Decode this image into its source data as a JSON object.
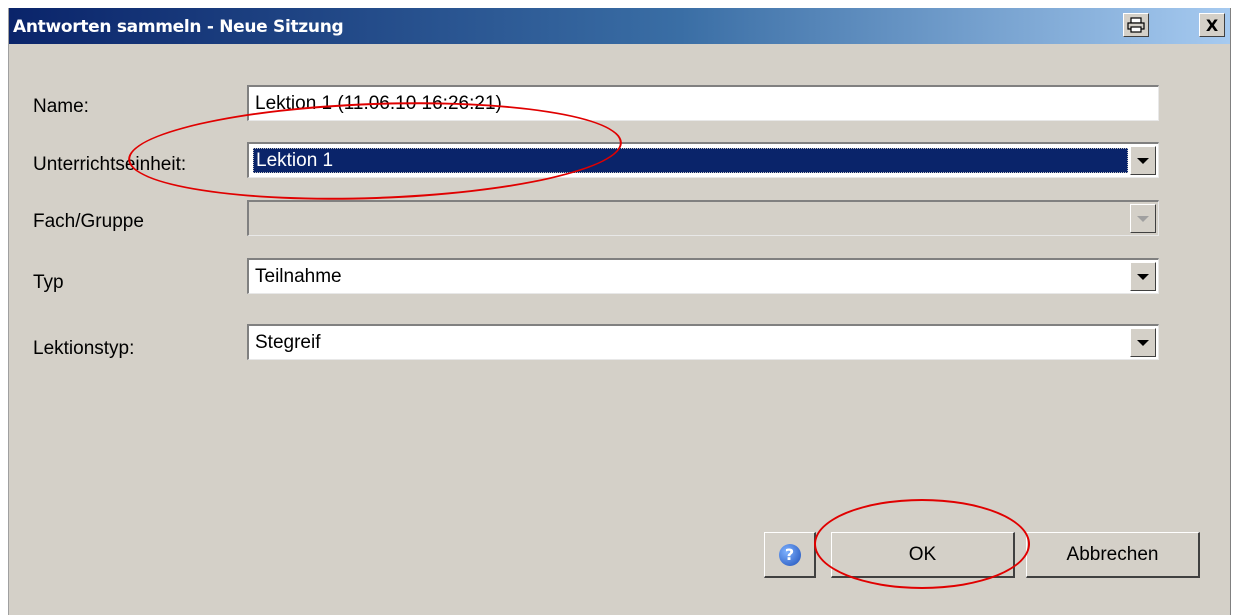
{
  "window": {
    "title": "Antworten sammeln - Neue Sitzung",
    "print_icon": "printer-icon",
    "close_glyph": "X"
  },
  "form": {
    "name": {
      "label": "Name:",
      "value": "Lektion 1 (11.06.10 16:26:21)"
    },
    "unit": {
      "label": "Unterrichtseinheit:",
      "value": "Lektion 1"
    },
    "subject": {
      "label": "Fach/Gruppe",
      "value": ""
    },
    "type": {
      "label": "Typ",
      "value": "Teilnahme"
    },
    "lesson_type": {
      "label": "Lektionstyp:",
      "value": "Stegreif"
    }
  },
  "buttons": {
    "help_icon": "help-icon",
    "help_glyph": "?",
    "ok": "OK",
    "cancel": "Abbrechen"
  },
  "colors": {
    "title_start": "#0a246a",
    "title_end": "#a6caf0",
    "selection": "#0a246a",
    "face": "#d4d0c8",
    "annotation": "#e00000"
  }
}
